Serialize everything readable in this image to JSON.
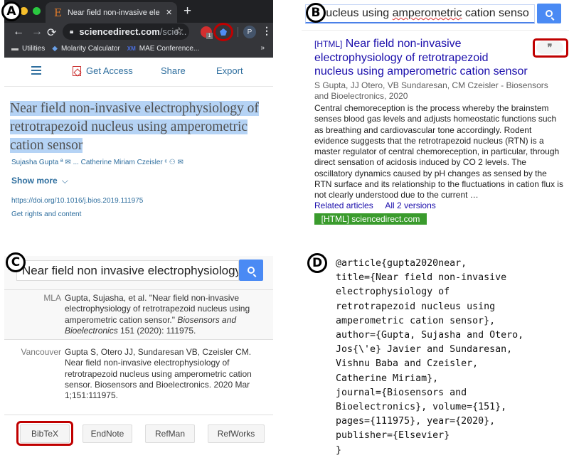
{
  "panel_labels": {
    "a": "A",
    "b": "B",
    "c": "C",
    "d": "D"
  },
  "panel_a": {
    "browser": {
      "tab_favicon": "E",
      "tab_title": "Near field non-invasive electrophysiology",
      "tab_close": "✕",
      "new_tab": "+",
      "back_icon": "←",
      "forward_icon": "→",
      "reload_icon": "⟳",
      "url_host": "sciencedirect.com",
      "url_path": "/scie...",
      "star_icon": "☆",
      "extension_badge": "1",
      "profile_initial": "P",
      "menu_icon": "⋮",
      "bookmarks": [
        {
          "icon": "folder-icon",
          "glyph": "▬",
          "label": "Utilities"
        },
        {
          "icon": "molarity-icon",
          "glyph": "◆",
          "label": "Molarity Calculator"
        },
        {
          "icon": "mae-icon",
          "glyph": "XM",
          "label": "MAE Conference..."
        }
      ],
      "bookmarks_overflow": "»"
    },
    "toolbar": {
      "get_access": "Get Access",
      "share": "Share",
      "export": "Export"
    },
    "article": {
      "title_lines": [
        "Near field non-invasive electrophysiology of",
        "retrotrapezoid nucleus using amperometric",
        "cation sensor"
      ],
      "authors": "Sujasha Gupta ª ✉ ... Catherine Miriam Czeisler ᶜ ⚇ ✉",
      "show_more": "Show more",
      "show_more_icon": "⌵",
      "doi": "https://doi.org/10.1016/j.bios.2019.111975",
      "rights": "Get rights and content"
    }
  },
  "panel_b": {
    "search_value_prefix": "d nucleus using ",
    "search_value_misspelled": "amperometric",
    "search_value_suffix": " cation senso",
    "result": {
      "tag": "[HTML]",
      "title": "Near field non-invasive electrophysiology of retrotrapezoid nucleus using amperometric cation sensor",
      "cite_icon": "❞",
      "meta": "S Gupta, JJ Otero, VB Sundaresan, CM Czeisler - Biosensors and Bioelectronics, 2020",
      "snippet": "Central chemoreception is the process whereby the brainstem senses blood gas levels and adjusts homeostatic functions such as breathing and cardiovascular tone accordingly. Rodent evidence suggests that the retrotrapezoid nucleus (RTN) is a master regulator of central chemoreception, in particular, through direct sensation of acidosis induced by CO 2 levels. The oscillatory dynamics caused by pH changes as sensed by the RTN surface and its relationship to the fluctuations in cation flux is not clearly understood due to the current …",
      "related": "Related articles",
      "versions": "All 2 versions",
      "source": "[HTML] sciencedirect.com"
    }
  },
  "panel_c": {
    "search_value": "Near field non invasive electrophysiology of",
    "citations": [
      {
        "style": "MLA",
        "text_plain": "Gupta, Sujasha, et al. \"Near field non-invasive electrophysiology of retrotrapezoid nucleus using amperometric cation sensor.\" ",
        "text_italic": "Biosensors and Bioelectronics",
        "text_tail": " 151 (2020): 111975."
      },
      {
        "style": "Vancouver",
        "text_plain": "Gupta S, Otero JJ, Sundaresan VB, Czeisler CM. Near field non-invasive electrophysiology of retrotrapezoid nucleus using amperometric cation sensor. Biosensors and Bioelectronics. 2020 Mar 1;151:111975."
      }
    ],
    "export_buttons": [
      "BibTeX",
      "EndNote",
      "RefMan",
      "RefWorks"
    ]
  },
  "panel_d": {
    "bibtex": "@article{gupta2020near,\ntitle={Near field non-invasive\nelectrophysiology of\nretrotrapezoid nucleus using\namperometric cation sensor},\nauthor={Gupta, Sujasha and Otero,\nJos{\\'e} Javier and Sundaresan,\nVishnu Baba and Czeisler,\nCatherine Miriam},\njournal={Biosensors and\nBioelectronics}, volume={151},\npages={111975}, year={2020},\npublisher={Elsevier}\n}"
  },
  "colors": {
    "highlight_ring": "#c00000",
    "link_blue": "#1a0dab",
    "sd_blue": "#2e6e9e",
    "search_blue": "#4a8af4",
    "source_green": "#3a9b2d",
    "selection": "#b5d3f5"
  }
}
